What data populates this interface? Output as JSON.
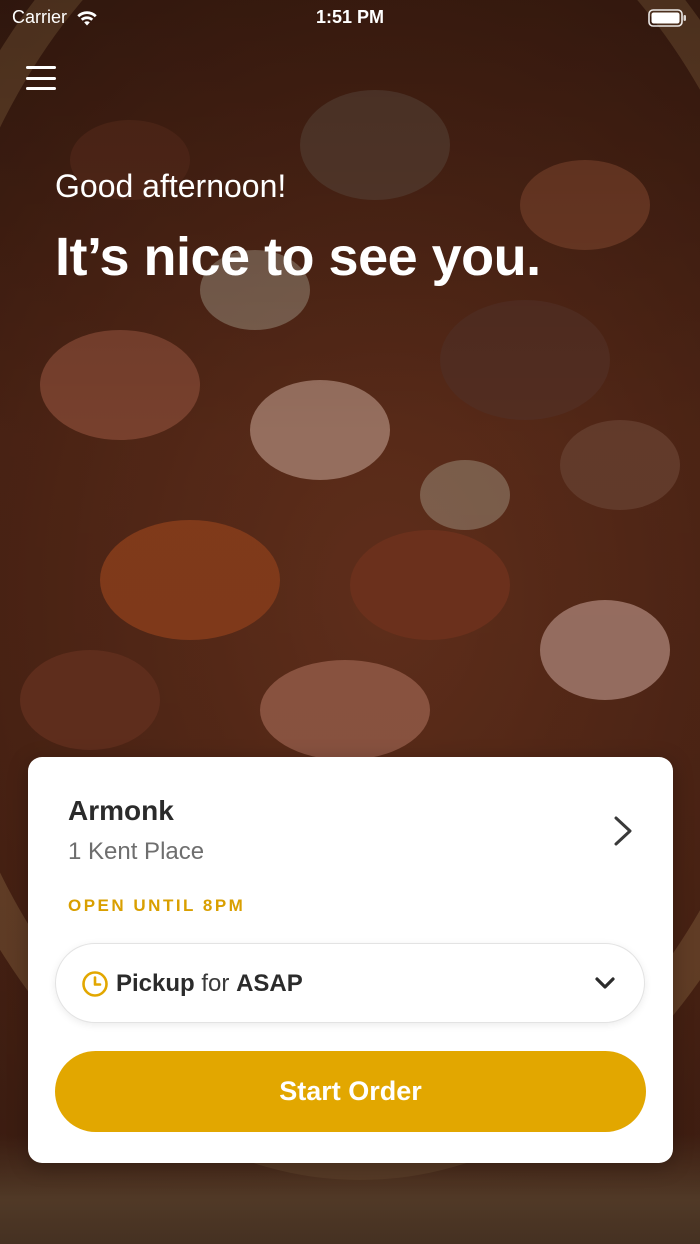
{
  "status_bar": {
    "carrier": "Carrier",
    "time": "1:51 PM",
    "icons": [
      "wifi-icon",
      "battery-icon"
    ]
  },
  "header": {
    "menu_icon": "hamburger-menu-icon",
    "greeting": "Good afternoon!",
    "headline": "It’s nice to see you."
  },
  "store": {
    "name": "Armonk",
    "address": "1 Kent Place",
    "hours": "OPEN UNTIL 8PM"
  },
  "order": {
    "mode": "Pickup",
    "connector": "for",
    "timing": "ASAP",
    "start_label": "Start Order"
  },
  "colors": {
    "accent": "#e2a700",
    "hours_text": "#d99f00",
    "card_bg": "#ffffff"
  }
}
